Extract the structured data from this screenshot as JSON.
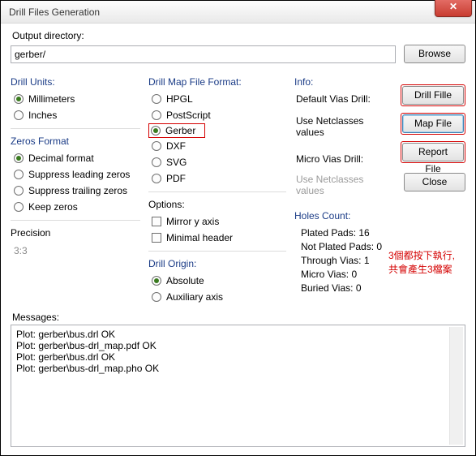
{
  "window": {
    "title": "Drill Files Generation"
  },
  "output": {
    "label": "Output directory:",
    "value": "gerber/",
    "browse": "Browse"
  },
  "units": {
    "title": "Drill Units:",
    "options": [
      "Millimeters",
      "Inches"
    ],
    "selected": "Millimeters"
  },
  "zeros": {
    "title": "Zeros Format",
    "options": [
      "Decimal format",
      "Suppress leading zeros",
      "Suppress trailing zeros",
      "Keep zeros"
    ],
    "selected": "Decimal format"
  },
  "precision": {
    "title": "Precision",
    "value": "3:3"
  },
  "mapformat": {
    "title": "Drill Map File Format:",
    "options": [
      "HPGL",
      "PostScript",
      "Gerber",
      "DXF",
      "SVG",
      "PDF"
    ],
    "selected": "Gerber"
  },
  "options": {
    "title": "Options:",
    "items": [
      "Mirror y axis",
      "Minimal header"
    ]
  },
  "origin": {
    "title": "Drill Origin:",
    "options": [
      "Absolute",
      "Auxiliary axis"
    ],
    "selected": "Absolute"
  },
  "info": {
    "title": "Info:",
    "default_vias": "Default Vias Drill:",
    "default_vias_val": "Use Netclasses values",
    "micro_vias": "Micro Vias Drill:",
    "micro_vias_val": "Use Netclasses values"
  },
  "holes": {
    "title": "Holes Count:",
    "items": [
      "Plated Pads: 16",
      "Not Plated Pads: 0",
      "Through Vias: 1",
      "Micro Vias: 0",
      "Buried Vias: 0"
    ]
  },
  "buttons": {
    "drill": "Drill Fille",
    "map": "Map File",
    "report": "Report File",
    "close": "Close"
  },
  "annotation": {
    "line1": "3個都按下執行,",
    "line2": "共會產生3檔案"
  },
  "messages": {
    "label": "Messages:",
    "lines": [
      "Plot: gerber\\bus.drl OK",
      "Plot: gerber\\bus-drl_map.pdf OK",
      "Plot: gerber\\bus.drl OK",
      "Plot: gerber\\bus-drl_map.pho OK"
    ]
  }
}
